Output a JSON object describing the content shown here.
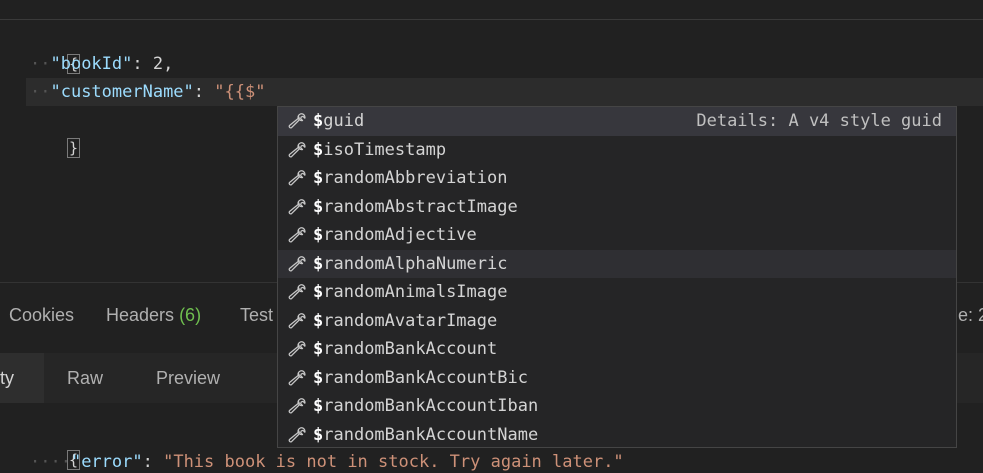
{
  "editor": {
    "open_brace": "{",
    "close_brace": "}",
    "line1": {
      "key": "\"bookId\"",
      "colon": ": ",
      "value": "2",
      "comma": ","
    },
    "line2": {
      "key": "\"customerName\"",
      "colon": ": ",
      "value": "\"{{$\""
    }
  },
  "suggest": {
    "items": [
      {
        "prefix": "$",
        "rest": "guid",
        "detail": "Details: A v4 style guid"
      },
      {
        "prefix": "$",
        "rest": "isoTimestamp"
      },
      {
        "prefix": "$",
        "rest": "randomAbbreviation"
      },
      {
        "prefix": "$",
        "rest": "randomAbstractImage"
      },
      {
        "prefix": "$",
        "rest": "randomAdjective"
      },
      {
        "prefix": "$",
        "rest": "randomAlphaNumeric"
      },
      {
        "prefix": "$",
        "rest": "randomAnimalsImage"
      },
      {
        "prefix": "$",
        "rest": "randomAvatarImage"
      },
      {
        "prefix": "$",
        "rest": "randomBankAccount"
      },
      {
        "prefix": "$",
        "rest": "randomBankAccountBic"
      },
      {
        "prefix": "$",
        "rest": "randomBankAccountIban"
      },
      {
        "prefix": "$",
        "rest": "randomBankAccountName"
      }
    ],
    "icon": "wrench-icon"
  },
  "response_tabs": {
    "cookies": "Cookies",
    "headers": "Headers",
    "headers_count": "(6)",
    "tests": "Test",
    "right_cut": "e: 2"
  },
  "body_tabs": {
    "pretty": "ty",
    "raw": "Raw",
    "preview": "Preview"
  },
  "response": {
    "open_brace": "{",
    "key": "\"error\"",
    "colon": ": ",
    "value": "\"This book is not in stock. Try again later.\""
  },
  "colors": {
    "background": "#212121",
    "key": "#9cdcfe",
    "string": "#ce9178",
    "count": "#6fbf4f"
  }
}
